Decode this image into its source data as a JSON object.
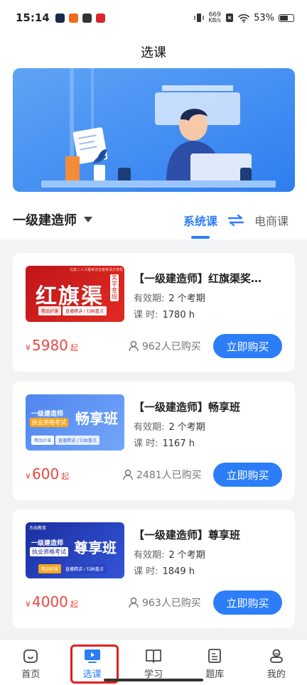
{
  "status_bar": {
    "time": "15:14",
    "net_speed_value": "669",
    "net_speed_unit": "KB/s",
    "battery": "53%",
    "battery_level": 0.53
  },
  "page": {
    "title": "选课",
    "category": "一级建造师",
    "tabs": [
      "系统课",
      "电商课"
    ]
  },
  "courses": [
    {
      "title": "【一级建造师】红旗渠奖…",
      "validity_label": "有效期:",
      "validity": "2 个考期",
      "hours_label": "课 时:",
      "hours": "1780 h",
      "price_currency": "¥",
      "price": "5980",
      "price_suffix": "起",
      "buyers": "962人已购买",
      "buy_label": "立即购买",
      "thumb": {
        "big_text": "红旗渠",
        "side_tag": "奖学金班",
        "top_text": "北进二人工程考试全套考试分享机",
        "pill1": "精品好课",
        "pill2": "直播精讲 / 归纳重点"
      }
    },
    {
      "title": "【一级建造师】畅享班",
      "validity_label": "有效期:",
      "validity": "2 个考期",
      "hours_label": "课 时:",
      "hours": "1167 h",
      "price_currency": "¥",
      "price": "600",
      "price_suffix": "起",
      "buyers": "2481人已购买",
      "buy_label": "立即购买",
      "thumb": {
        "line1": "一级建造师",
        "line2": "执业资格考试",
        "big_text": "畅享班",
        "pill1": "精品好课",
        "pill2": "直播精讲 / 归纳重点"
      }
    },
    {
      "title": "【一级建造师】尊享班",
      "validity_label": "有效期:",
      "validity": "2 个考期",
      "hours_label": "课 时:",
      "hours": "1849 h",
      "price_currency": "¥",
      "price": "4000",
      "price_suffix": "起",
      "buyers": "963人已购买",
      "buy_label": "立即购买",
      "thumb": {
        "brand": "杰出教育",
        "line1": "一级建造师",
        "line2": "执业资格考试",
        "big_text": "尊享班",
        "pill1": "精品好课",
        "pill2": "直播精讲 / 归纳重点"
      }
    }
  ],
  "bottom_nav": [
    {
      "label": "首页",
      "icon": "home-icon"
    },
    {
      "label": "选课",
      "icon": "play-tv-icon"
    },
    {
      "label": "学习",
      "icon": "book-icon"
    },
    {
      "label": "题库",
      "icon": "document-icon"
    },
    {
      "label": "我的",
      "icon": "user-icon"
    }
  ],
  "colors": {
    "accent": "#2c7ef8",
    "price": "#e8483f",
    "highlight": "#e02020"
  }
}
